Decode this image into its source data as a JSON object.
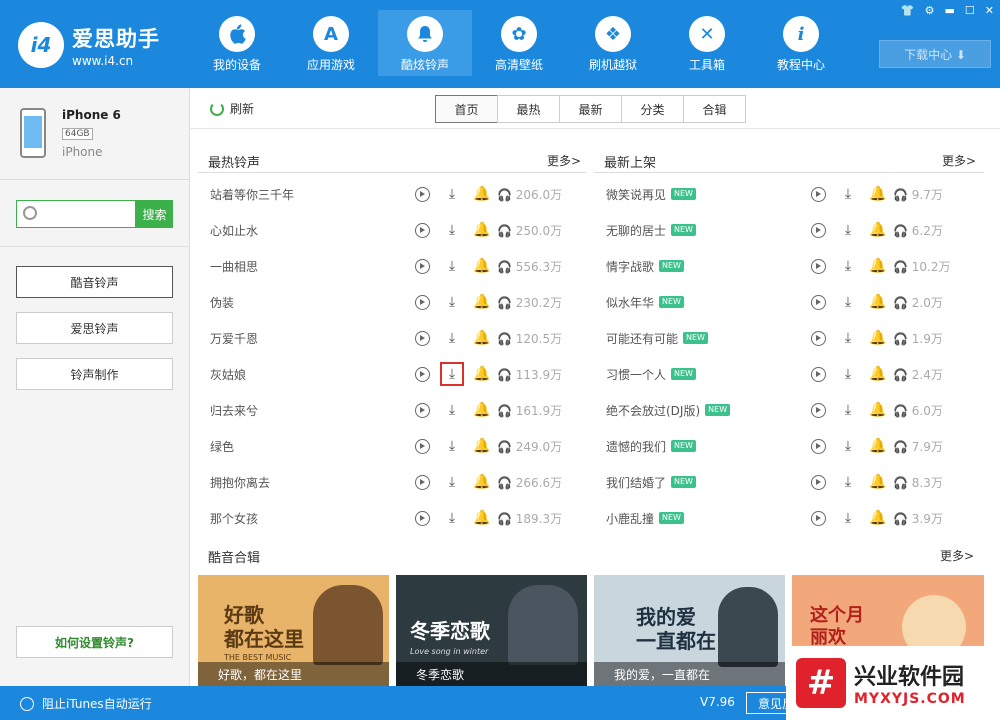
{
  "logo": {
    "mark": "i4",
    "title": "爱思助手",
    "url": "www.i4.cn"
  },
  "nav": [
    {
      "label": "我的设备",
      "icon": "apple-icon",
      "glyph": ""
    },
    {
      "label": "应用游戏",
      "icon": "appstore-icon",
      "glyph": "A"
    },
    {
      "label": "酷炫铃声",
      "icon": "bell-icon",
      "glyph": "🔔"
    },
    {
      "label": "高清壁纸",
      "icon": "flower-icon",
      "glyph": "✿"
    },
    {
      "label": "刷机越狱",
      "icon": "dropbox-icon",
      "glyph": "❖"
    },
    {
      "label": "工具箱",
      "icon": "tools-icon",
      "glyph": "✕"
    },
    {
      "label": "教程中心",
      "icon": "info-icon",
      "glyph": "i"
    }
  ],
  "download_center": "下载中心 ⬇",
  "device": {
    "name": "iPhone 6",
    "capacity": "64GB",
    "model": "iPhone"
  },
  "search": {
    "placeholder": "",
    "button": "搜索"
  },
  "side_menu": [
    "酷音铃声",
    "爱思铃声",
    "铃声制作"
  ],
  "howto": "如何设置铃声?",
  "refresh": "刷新",
  "tabs": [
    "首页",
    "最热",
    "最新",
    "分类",
    "合辑"
  ],
  "hot": {
    "title": "最热铃声",
    "more": "更多>",
    "items": [
      {
        "name": "站着等你三千年",
        "plays": "206.0万"
      },
      {
        "name": "心如止水",
        "plays": "250.0万"
      },
      {
        "name": "一曲相思",
        "plays": "556.3万"
      },
      {
        "name": "伪装",
        "plays": "230.2万"
      },
      {
        "name": "万爱千恩",
        "plays": "120.5万"
      },
      {
        "name": "灰姑娘",
        "plays": "113.9万"
      },
      {
        "name": "归去来兮",
        "plays": "161.9万"
      },
      {
        "name": "绿色",
        "plays": "249.0万"
      },
      {
        "name": "拥抱你离去",
        "plays": "266.6万"
      },
      {
        "name": "那个女孩",
        "plays": "189.3万"
      }
    ]
  },
  "latest": {
    "title": "最新上架",
    "more": "更多>",
    "new_badge": "NEW",
    "items": [
      {
        "name": "微笑说再见",
        "plays": "9.7万"
      },
      {
        "name": "无聊的居士",
        "plays": "6.2万"
      },
      {
        "name": "情字战歌",
        "plays": "10.2万"
      },
      {
        "name": "似水年华",
        "plays": "2.0万"
      },
      {
        "name": "可能还有可能",
        "plays": "1.9万"
      },
      {
        "name": "习惯一个人",
        "plays": "2.4万"
      },
      {
        "name": "绝不会放过(DJ版)",
        "plays": "6.0万"
      },
      {
        "name": "遗憾的我们",
        "plays": "7.9万"
      },
      {
        "name": "我们结婚了",
        "plays": "8.3万"
      },
      {
        "name": "小鹿乱撞",
        "plays": "3.9万"
      }
    ]
  },
  "albums_section": {
    "title": "酷音合辑",
    "more": "更多>",
    "items": [
      {
        "big": "好歌\n都在这里",
        "sub": "THE BEST MUSIC",
        "caption": "好歌，都在这里",
        "bg": "#e8b46a"
      },
      {
        "big": "冬季恋歌",
        "sub": "Love song in winter",
        "caption": "冬季恋歌",
        "bg": "#2d3a40"
      },
      {
        "big": "我的爱\n一直都在",
        "sub": "",
        "caption": "我的爱，一直都在",
        "bg": "#c9d6de"
      },
      {
        "big": "这个月\n丽欢",
        "sub": "",
        "caption": "",
        "bg": "#f2a87a"
      }
    ]
  },
  "status": {
    "itunes": "阻止iTunes自动运行",
    "version": "V7.96",
    "feedback": "意见反"
  },
  "watermark": {
    "logo": "#",
    "title": "兴业软件园",
    "url": "MYXYJS.COM"
  },
  "colors": {
    "brand": "#1b88dd",
    "green": "#3cb04a",
    "highlight": "#d9322b"
  }
}
